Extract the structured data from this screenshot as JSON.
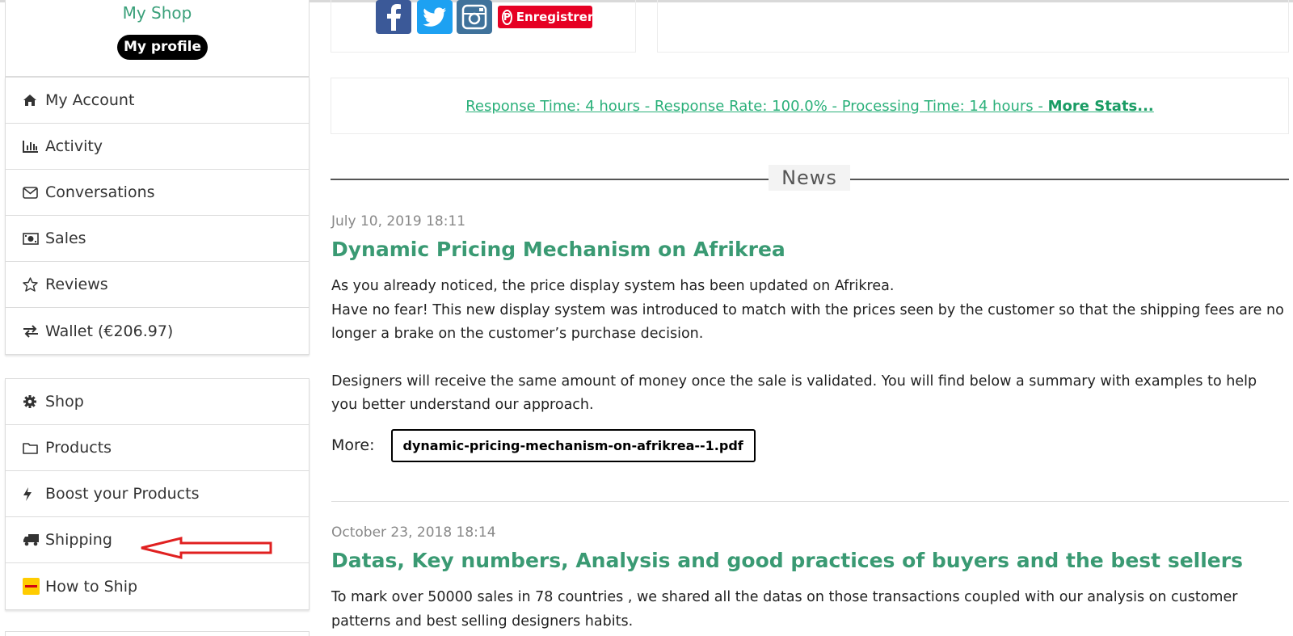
{
  "sidebar": {
    "shop_name": "My Shop",
    "profile_button": "My profile",
    "group1": [
      {
        "label": "My Account",
        "icon": "home-icon"
      },
      {
        "label": "Activity",
        "icon": "bar-chart-icon"
      },
      {
        "label": "Conversations",
        "icon": "envelope-icon"
      },
      {
        "label": "Sales",
        "icon": "money-icon"
      },
      {
        "label": "Reviews",
        "icon": "star-icon"
      },
      {
        "label": "Wallet (€206.97)",
        "icon": "exchange-icon"
      }
    ],
    "group2": [
      {
        "label": "Shop",
        "icon": "gear-icon"
      },
      {
        "label": "Products",
        "icon": "folder-icon"
      },
      {
        "label": "Boost your Products",
        "icon": "bolt-icon"
      },
      {
        "label": "Shipping",
        "icon": "truck-icon"
      },
      {
        "label": "How to Ship",
        "icon": "dhl-icon"
      }
    ]
  },
  "social": {
    "pinterest_label": "Enregistrer",
    "colors": {
      "facebook": "#3b5998",
      "twitter": "#1da1f2",
      "instagram": "#3f729b",
      "pinterest": "#e60023"
    }
  },
  "stats": {
    "text": "Response Time: 4 hours  - Response Rate: 100.0%  - Processing Time: 14 hours  - ",
    "more_link": "More Stats..."
  },
  "news": {
    "heading": "News",
    "articles": [
      {
        "date": "July 10, 2019 18:11",
        "title": "Dynamic Pricing Mechanism on Afrikrea",
        "paragraph1": "As you already noticed, the price display system has been updated on Afrikrea.\nHave no fear! This new display system was introduced to match with the prices seen by the customer so that the shipping fees are no longer a brake on the customer’s purchase decision.",
        "paragraph2": "Designers will receive the same amount of money once the sale is validated. You will find below a summary with examples to help you better understand our approach.",
        "more_label": "More:",
        "attachment": "dynamic-pricing-mechanism-on-afrikrea--1.pdf"
      },
      {
        "date": "October 23, 2018 18:14",
        "title": "Datas, Key numbers, Analysis and good practices of buyers and the best sellers",
        "paragraph1": "To mark over 50000 sales in 78 countries , we shared all the datas on those transactions coupled with our analysis on customer patterns and best selling designers habits."
      }
    ]
  },
  "colors": {
    "accent_green": "#3a9a73",
    "link_green": "#2bb07a",
    "annotation_red": "#e02020"
  }
}
